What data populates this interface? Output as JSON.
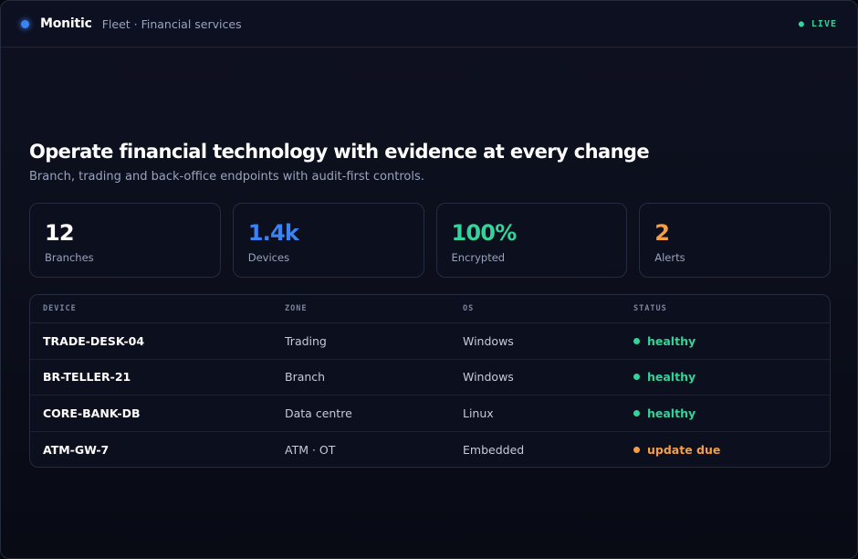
{
  "app": {
    "name": "Monitic",
    "context": "Fleet · Financial services",
    "live_label": "● LIVE"
  },
  "hero": {
    "title": "Operate financial technology with evidence at every change",
    "subtitle": "Branch, trading and back-office endpoints with audit-first controls."
  },
  "stats": [
    {
      "value": "12",
      "label": "Branches",
      "color": "#ffffff"
    },
    {
      "value": "1.4k",
      "label": "Devices",
      "color": "#3b82f6"
    },
    {
      "value": "100%",
      "label": "Encrypted",
      "color": "#34d399"
    },
    {
      "value": "2",
      "label": "Alerts",
      "color": "#f59e42"
    }
  ],
  "table": {
    "headers": [
      "DEVICE",
      "ZONE",
      "OS",
      "STATUS"
    ],
    "rows": [
      {
        "device": "TRADE-DESK-04",
        "zone": "Trading",
        "os": "Windows",
        "status": "healthy",
        "status_color": "#34d399"
      },
      {
        "device": "BR-TELLER-21",
        "zone": "Branch",
        "os": "Windows",
        "status": "healthy",
        "status_color": "#34d399"
      },
      {
        "device": "CORE-BANK-DB",
        "zone": "Data centre",
        "os": "Linux",
        "status": "healthy",
        "status_color": "#34d399"
      },
      {
        "device": "ATM-GW-7",
        "zone": "ATM · OT",
        "os": "Embedded",
        "status": "update due",
        "status_color": "#f59e42"
      }
    ]
  }
}
